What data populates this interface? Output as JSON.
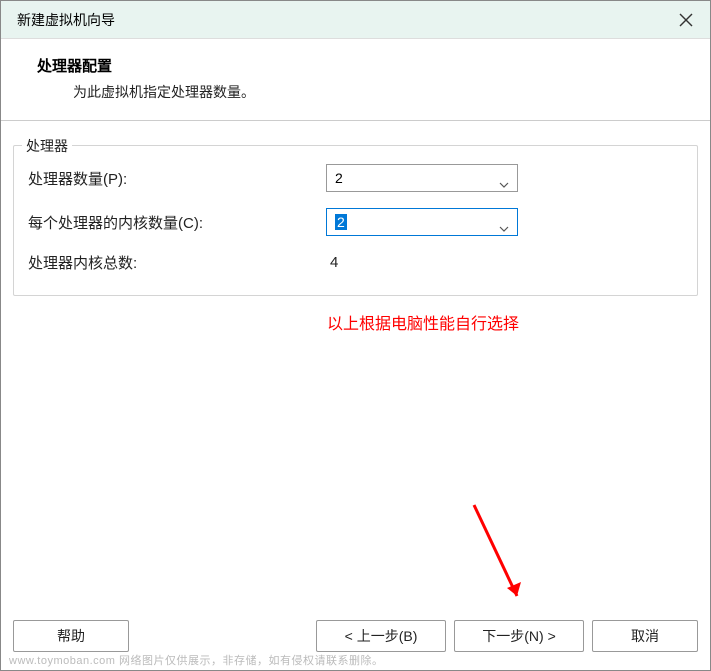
{
  "window": {
    "title": "新建虚拟机向导"
  },
  "header": {
    "title": "处理器配置",
    "subtitle": "为此虚拟机指定处理器数量。"
  },
  "fieldset": {
    "legend": "处理器",
    "rows": {
      "processorCount": {
        "label": "处理器数量(P):",
        "value": "2"
      },
      "coresPerProcessor": {
        "label": "每个处理器的内核数量(C):",
        "value": "2"
      },
      "totalCores": {
        "label": "处理器内核总数:",
        "value": "4"
      }
    }
  },
  "annotation": "以上根据电脑性能自行选择",
  "buttons": {
    "help": "帮助",
    "back": "< 上一步(B)",
    "next": "下一步(N) >",
    "cancel": "取消"
  },
  "watermark": "www.toymoban.com 网络图片仅供展示，非存储，如有侵权请联系删除。"
}
